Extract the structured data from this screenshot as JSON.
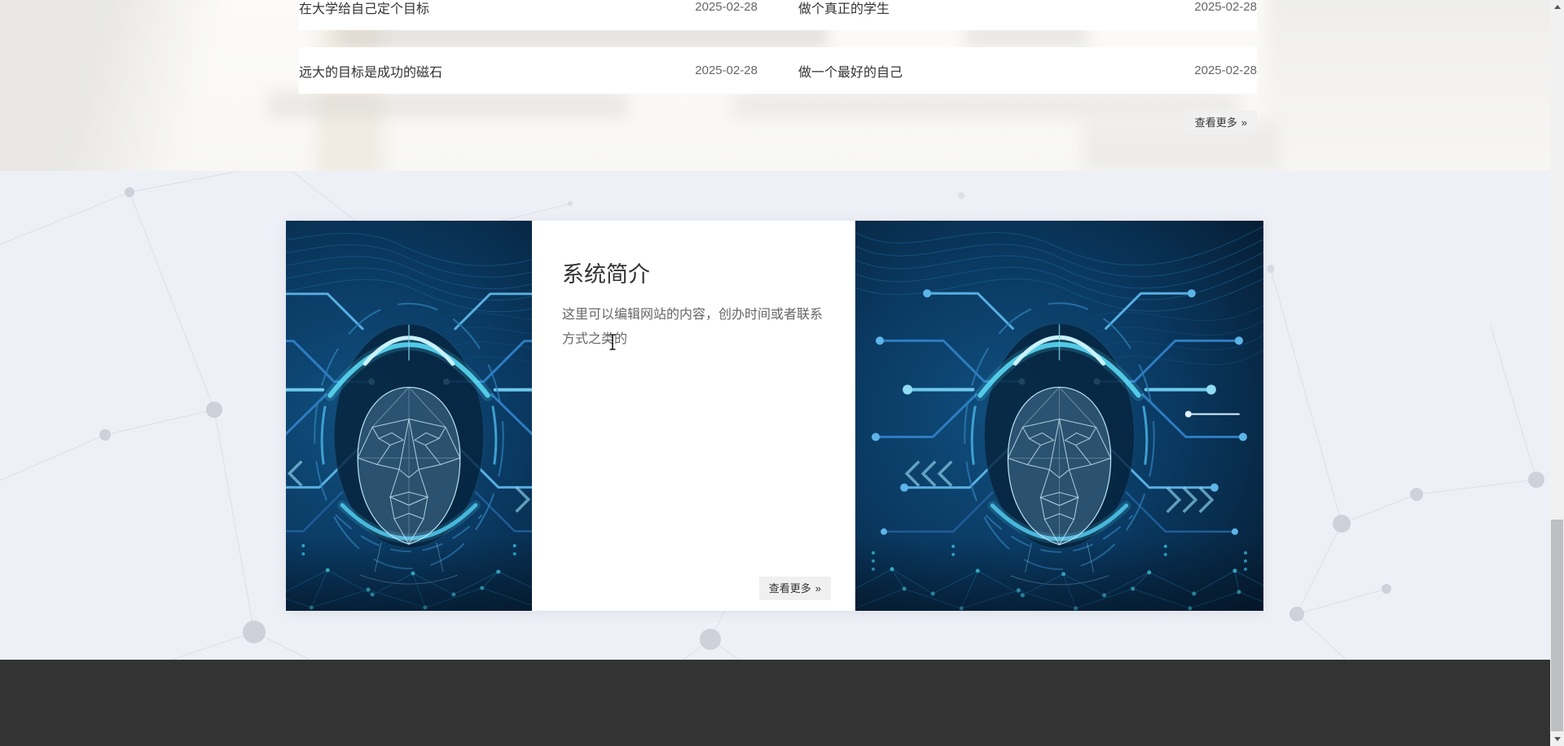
{
  "news": {
    "rows": [
      {
        "left": {
          "title": "在大学给自己定个目标",
          "date": "2025-02-28"
        },
        "right": {
          "title": "做个真正的学生",
          "date": "2025-02-28"
        }
      },
      {
        "left": {
          "title": "远大的目标是成功的磁石",
          "date": "2025-02-28"
        },
        "right": {
          "title": "做一个最好的自己",
          "date": "2025-02-28"
        }
      }
    ],
    "more_label": "查看更多",
    "more_arrow": "»"
  },
  "intro": {
    "title": "系统简介",
    "body": "这里可以编辑网站的内容，创办时间或者联系方式之类的",
    "more_label": "查看更多",
    "more_arrow": "»"
  },
  "images": {
    "left_alt": "face-recognition-tech-image",
    "right_alt": "face-recognition-tech-image"
  },
  "colors": {
    "footer_bg": "#333333",
    "section_bg": "#eef0f7",
    "button_bg": "#f0f0f0",
    "accent_cyan": "#59d7f2",
    "accent_blue": "#2f7fb8"
  }
}
